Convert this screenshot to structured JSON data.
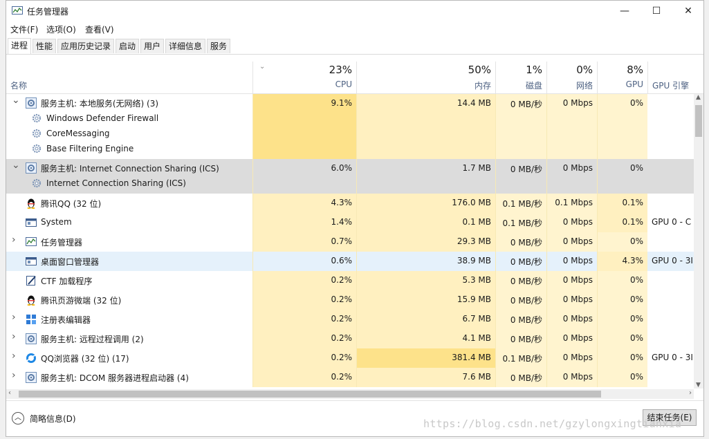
{
  "window": {
    "title": "任务管理器",
    "min": "—",
    "max": "☐",
    "close": "✕"
  },
  "menu": [
    "文件(F)",
    "选项(O)",
    "查看(V)"
  ],
  "tabs": [
    "进程",
    "性能",
    "应用历史记录",
    "启动",
    "用户",
    "详细信息",
    "服务"
  ],
  "active_tab": 0,
  "columns": {
    "name": "名称",
    "cpu": {
      "pct": "23%",
      "label": "CPU"
    },
    "mem": {
      "pct": "50%",
      "label": "内存"
    },
    "disk": {
      "pct": "1%",
      "label": "磁盘"
    },
    "net": {
      "pct": "0%",
      "label": "网络"
    },
    "gpu": {
      "pct": "8%",
      "label": "GPU"
    },
    "gpueng": {
      "label": "GPU 引擎"
    }
  },
  "rows": [
    {
      "name": "服务主机: 本地服务(无网络) (3)",
      "expanded": true,
      "icon": "gear-icon",
      "cpu": "9.1%",
      "mem": "14.4 MB",
      "disk": "0 MB/秒",
      "net": "0 Mbps",
      "gpu": "0%",
      "eng": "",
      "children": [
        "Windows Defender Firewall",
        "CoreMessaging",
        "Base Filtering Engine"
      ]
    },
    {
      "name": "服务主机: Internet Connection Sharing (ICS)",
      "expanded": true,
      "icon": "gear-icon",
      "cpu": "6.0%",
      "mem": "1.7 MB",
      "disk": "0 MB/秒",
      "net": "0 Mbps",
      "gpu": "0%",
      "eng": "",
      "children": [
        "Internet Connection Sharing (ICS)"
      ]
    },
    {
      "name": "腾讯QQ (32 位)",
      "icon": "qq-penguin-icon",
      "cpu": "4.3%",
      "mem": "176.0 MB",
      "disk": "0.1 MB/秒",
      "net": "0.1 Mbps",
      "gpu": "0.1%",
      "eng": ""
    },
    {
      "name": "System",
      "icon": "system-window-icon",
      "cpu": "1.4%",
      "mem": "0.1 MB",
      "disk": "0.1 MB/秒",
      "net": "0 Mbps",
      "gpu": "0.1%",
      "eng": "GPU 0 - C"
    },
    {
      "name": "任务管理器",
      "expandable": true,
      "icon": "task-manager-icon",
      "cpu": "0.7%",
      "mem": "29.3 MB",
      "disk": "0 MB/秒",
      "net": "0 Mbps",
      "gpu": "0%",
      "eng": ""
    },
    {
      "name": "桌面窗口管理器",
      "icon": "system-window-icon",
      "cpu": "0.6%",
      "mem": "38.9 MB",
      "disk": "0 MB/秒",
      "net": "0 Mbps",
      "gpu": "4.3%",
      "eng": "GPU 0 - 3I"
    },
    {
      "name": "CTF 加载程序",
      "icon": "ctf-pen-icon",
      "cpu": "0.2%",
      "mem": "5.3 MB",
      "disk": "0 MB/秒",
      "net": "0 Mbps",
      "gpu": "0%",
      "eng": ""
    },
    {
      "name": "腾讯页游微端 (32 位)",
      "icon": "qq-penguin-icon",
      "cpu": "0.2%",
      "mem": "15.9 MB",
      "disk": "0 MB/秒",
      "net": "0 Mbps",
      "gpu": "0%",
      "eng": ""
    },
    {
      "name": "注册表编辑器",
      "expandable": true,
      "icon": "registry-icon",
      "cpu": "0.2%",
      "mem": "6.7 MB",
      "disk": "0 MB/秒",
      "net": "0 Mbps",
      "gpu": "0%",
      "eng": ""
    },
    {
      "name": "服务主机: 远程过程调用 (2)",
      "expandable": true,
      "icon": "gear-icon",
      "cpu": "0.2%",
      "mem": "4.1 MB",
      "disk": "0 MB/秒",
      "net": "0 Mbps",
      "gpu": "0%",
      "eng": ""
    },
    {
      "name": "QQ浏览器 (32 位) (17)",
      "expandable": true,
      "icon": "qq-browser-icon",
      "cpu": "0.2%",
      "mem": "381.4 MB",
      "disk": "0.1 MB/秒",
      "net": "0 Mbps",
      "gpu": "0%",
      "eng": "GPU 0 - 3I"
    },
    {
      "name": "服务主机: DCOM 服务器进程启动器 (4)",
      "expandable": true,
      "icon": "gear-icon",
      "cpu": "0.2%",
      "mem": "7.6 MB",
      "disk": "0 MB/秒",
      "net": "0 Mbps",
      "gpu": "0%",
      "eng": ""
    }
  ],
  "footer": {
    "fewer": "简略信息(D)",
    "end_task": "结束任务(E)"
  },
  "watermark": "https://blog.csdn.net/gzylongxingtianxia",
  "colors": {
    "heat_high": "#fde28a",
    "heat_mid": "#fff0c0",
    "heat_low": "#fff4cf",
    "selected": "#dcdcdc",
    "hover": "#e5f1fb"
  }
}
